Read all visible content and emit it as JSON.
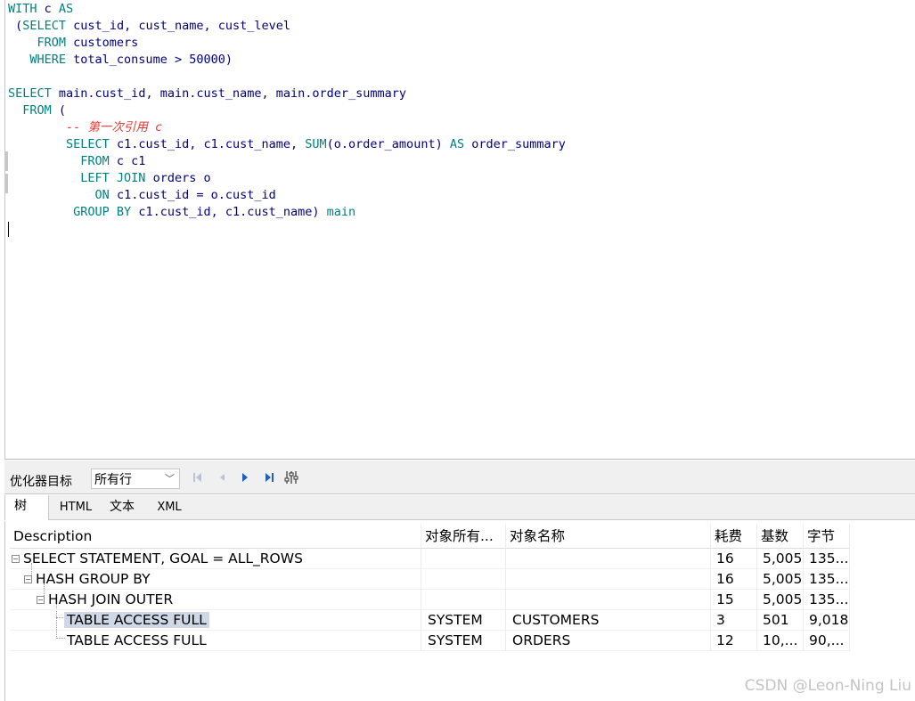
{
  "editor": {
    "lines": [
      [
        {
          "t": "WITH",
          "c": "kw"
        },
        {
          "t": " c ",
          "c": "id"
        },
        {
          "t": "AS",
          "c": "kw"
        }
      ],
      [
        {
          "t": " (",
          "c": "id"
        },
        {
          "t": "SELECT",
          "c": "kw"
        },
        {
          "t": " cust_id, cust_name, cust_level",
          "c": "id"
        }
      ],
      [
        {
          "t": "    ",
          "c": "id"
        },
        {
          "t": "FROM",
          "c": "kw"
        },
        {
          "t": " customers",
          "c": "id"
        }
      ],
      [
        {
          "t": "   ",
          "c": "id"
        },
        {
          "t": "WHERE",
          "c": "kw"
        },
        {
          "t": " total_consume > 50000)",
          "c": "id"
        }
      ],
      [],
      [
        {
          "t": "SELECT",
          "c": "kw"
        },
        {
          "t": " main.cust_id, main.cust_name, main.order_summary",
          "c": "id"
        }
      ],
      [
        {
          "t": "  ",
          "c": "id"
        },
        {
          "t": "FROM",
          "c": "kw"
        },
        {
          "t": " (",
          "c": "id"
        }
      ],
      [
        {
          "t": "        ",
          "c": "id"
        },
        {
          "t": "-- 第一次引用 c",
          "c": "cmt"
        }
      ],
      [
        {
          "t": "        ",
          "c": "id"
        },
        {
          "t": "SELECT",
          "c": "kw"
        },
        {
          "t": " c1.cust_id, c1.cust_name, ",
          "c": "id"
        },
        {
          "t": "SUM",
          "c": "kw"
        },
        {
          "t": "(o.order_amount) ",
          "c": "id"
        },
        {
          "t": "AS",
          "c": "kw"
        },
        {
          "t": " order_summary",
          "c": "id"
        }
      ],
      [
        {
          "t": "          ",
          "c": "id"
        },
        {
          "t": "FROM",
          "c": "kw"
        },
        {
          "t": " c c1",
          "c": "id"
        }
      ],
      [
        {
          "t": "          ",
          "c": "id"
        },
        {
          "t": "LEFT JOIN",
          "c": "kw"
        },
        {
          "t": " orders o",
          "c": "id"
        }
      ],
      [
        {
          "t": "            ",
          "c": "id"
        },
        {
          "t": "ON",
          "c": "kw"
        },
        {
          "t": " c1.cust_id = o.cust_id",
          "c": "id"
        }
      ],
      [
        {
          "t": "         ",
          "c": "id"
        },
        {
          "t": "GROUP BY",
          "c": "kw"
        },
        {
          "t": " c1.cust_id, c1.cust_name) ",
          "c": "id"
        },
        {
          "t": "main",
          "c": "kw"
        }
      ]
    ]
  },
  "toolbar": {
    "optimizer_label": "优化器目标",
    "optimizer_value": "所有行",
    "first_icon": "first-page-icon",
    "prev_icon": "previous-icon",
    "next_icon": "next-icon",
    "last_icon": "last-page-icon",
    "settings_icon": "column-settings-icon"
  },
  "tabs": [
    {
      "label": "树",
      "active": true
    },
    {
      "label": "HTML",
      "active": false
    },
    {
      "label": "文本",
      "active": false
    },
    {
      "label": "XML",
      "active": false
    }
  ],
  "plan": {
    "headers": [
      "Description",
      "对象所有...",
      "对象名称",
      "耗费",
      "基数",
      "字节"
    ],
    "rows": [
      {
        "desc": "SELECT STATEMENT, GOAL = ALL_ROWS",
        "owner": "",
        "object": "",
        "cost": "16",
        "card": "5,005",
        "bytes": "135..."
      },
      {
        "desc": "HASH GROUP BY",
        "owner": "",
        "object": "",
        "cost": "16",
        "card": "5,005",
        "bytes": "135..."
      },
      {
        "desc": "HASH JOIN OUTER",
        "owner": "",
        "object": "",
        "cost": "15",
        "card": "5,005",
        "bytes": "135..."
      },
      {
        "desc": "TABLE ACCESS FULL",
        "owner": "SYSTEM",
        "object": "CUSTOMERS",
        "cost": "3",
        "card": "501",
        "bytes": "9,018"
      },
      {
        "desc": "TABLE ACCESS FULL",
        "owner": "SYSTEM",
        "object": "ORDERS",
        "cost": "12",
        "card": "10,...",
        "bytes": "90,..."
      }
    ]
  },
  "watermark": "CSDN @Leon-Ning Liu"
}
